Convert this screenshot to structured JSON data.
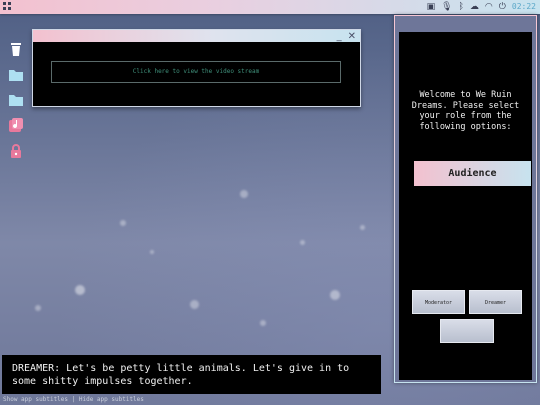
{
  "topbar": {
    "clock": "02:22",
    "tray_icons": [
      "battery-icon",
      "mic-icon",
      "bluetooth-icon",
      "cloud-icon",
      "wifi-icon",
      "power-icon"
    ]
  },
  "desktop_icons": [
    "trash-icon",
    "folder-icon",
    "folder-icon",
    "music-folder-icon",
    "lock-icon"
  ],
  "video_window": {
    "minimize": "_",
    "close": "✕",
    "stream_button": "Click here to view the video stream"
  },
  "role_panel": {
    "welcome": "Welcome to We Ruin Dreams. Please select your role from the following options:",
    "audience_button": "Audience",
    "moderator_button": "Moderator",
    "dreamer_button": "Dreamer",
    "third_button": ""
  },
  "subtitles": {
    "text": "DREAMER: Let's be petty little animals. Let's give in to some shitty impulses together.",
    "show_link": "Show app subtitles",
    "separator": " | ",
    "hide_link": "Hide app subtitles"
  },
  "colors": {
    "accent_pink": "#f3c1cf",
    "accent_blue": "#c7e3ef",
    "icon_pink": "#e8799c",
    "clock": "#5ca8c8"
  }
}
